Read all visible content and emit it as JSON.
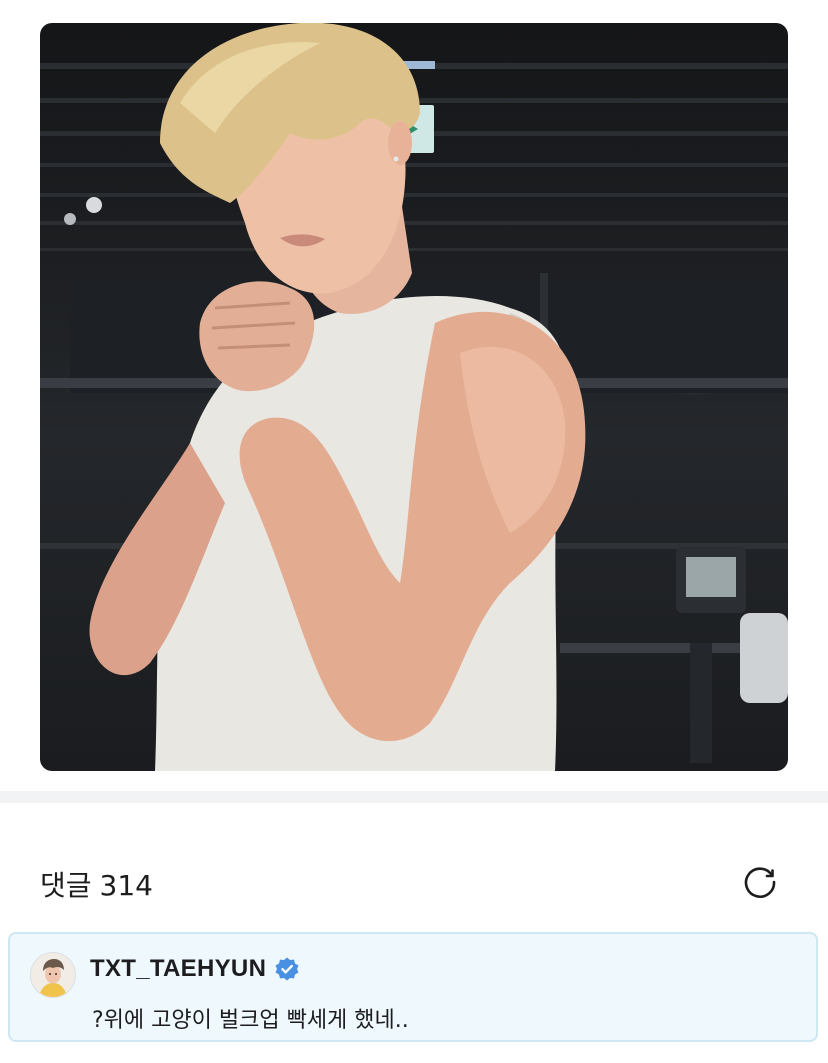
{
  "post": {
    "photo_description_icon": "post-photo"
  },
  "comments": {
    "label": "댓글",
    "count": "314",
    "refresh_icon": "refresh-icon"
  },
  "highlighted_comment": {
    "author": "TXT_TAEHYUN",
    "verified_icon": "verified-badge-icon",
    "text": "?위에 고양이 벌크업 빡세게 했네..",
    "card_color": "#eef8fd",
    "border_color": "#cde7f3",
    "badge_color": "#4a90e2"
  }
}
